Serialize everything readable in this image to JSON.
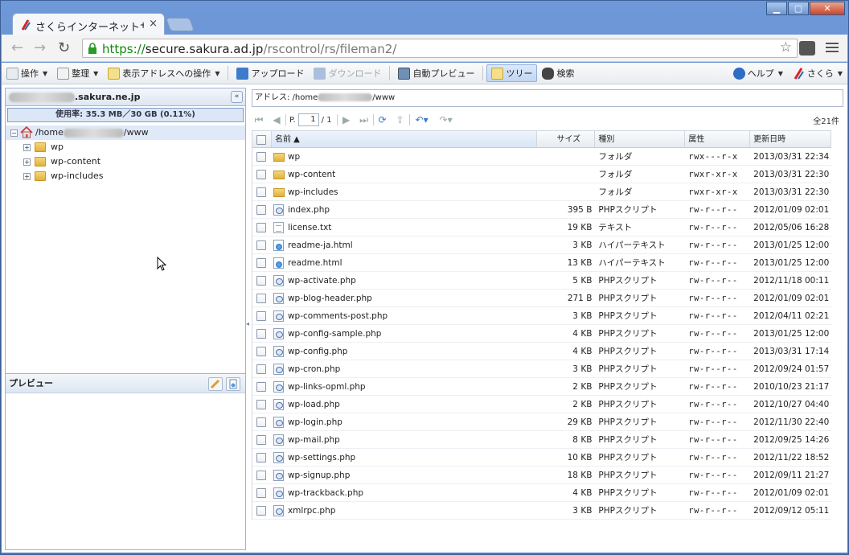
{
  "browser": {
    "tab_title": "さくらインターネットサ…",
    "url_scheme": "https://",
    "url_host": "secure.sakura.ad.jp",
    "url_path": "/rscontrol/rs/fileman2/"
  },
  "toolbar": {
    "operation": "操作",
    "organize": "整理",
    "address_ops": "表示アドレスへの操作",
    "upload": "アップロード",
    "download": "ダウンロード",
    "auto_preview": "自動プレビュー",
    "tree": "ツリー",
    "search": "検索",
    "help": "ヘルプ",
    "sakura": "さくら"
  },
  "left": {
    "domain_suffix": ".sakura.ne.jp",
    "usage": "使用率: 35.3 MB／30 GB (0.11%)",
    "root_prefix": "/home",
    "root_suffix": "/www",
    "tree_items": [
      "wp",
      "wp-content",
      "wp-includes"
    ],
    "preview_label": "プレビュー"
  },
  "right": {
    "address_prefix": "アドレス: /home",
    "address_suffix": "/www",
    "page_label": "P.",
    "page_current": "1",
    "page_total": "/ 1",
    "total": "全21件",
    "columns": [
      "名前 ▲",
      "サイズ",
      "種別",
      "属性",
      "更新日時"
    ],
    "files": [
      {
        "name": "wp",
        "size": "",
        "type": "フォルダ",
        "perm": "rwx---r-x",
        "date": "2013/03/31 22:34",
        "icon": "folder"
      },
      {
        "name": "wp-content",
        "size": "",
        "type": "フォルダ",
        "perm": "rwxr-xr-x",
        "date": "2013/03/31 22:30",
        "icon": "folder"
      },
      {
        "name": "wp-includes",
        "size": "",
        "type": "フォルダ",
        "perm": "rwxr-xr-x",
        "date": "2013/03/31 22:30",
        "icon": "folder"
      },
      {
        "name": "index.php",
        "size": "395 B",
        "type": "PHPスクリプト",
        "perm": "rw-r--r--",
        "date": "2012/01/09 02:01",
        "icon": "php"
      },
      {
        "name": "license.txt",
        "size": "19 KB",
        "type": "テキスト",
        "perm": "rw-r--r--",
        "date": "2012/05/06 16:28",
        "icon": "txt"
      },
      {
        "name": "readme-ja.html",
        "size": "3 KB",
        "type": "ハイパーテキスト",
        "perm": "rw-r--r--",
        "date": "2013/01/25 12:00",
        "icon": "html"
      },
      {
        "name": "readme.html",
        "size": "13 KB",
        "type": "ハイパーテキスト",
        "perm": "rw-r--r--",
        "date": "2013/01/25 12:00",
        "icon": "html"
      },
      {
        "name": "wp-activate.php",
        "size": "5 KB",
        "type": "PHPスクリプト",
        "perm": "rw-r--r--",
        "date": "2012/11/18 00:11",
        "icon": "php"
      },
      {
        "name": "wp-blog-header.php",
        "size": "271 B",
        "type": "PHPスクリプト",
        "perm": "rw-r--r--",
        "date": "2012/01/09 02:01",
        "icon": "php"
      },
      {
        "name": "wp-comments-post.php",
        "size": "3 KB",
        "type": "PHPスクリプト",
        "perm": "rw-r--r--",
        "date": "2012/04/11 02:21",
        "icon": "php"
      },
      {
        "name": "wp-config-sample.php",
        "size": "4 KB",
        "type": "PHPスクリプト",
        "perm": "rw-r--r--",
        "date": "2013/01/25 12:00",
        "icon": "php"
      },
      {
        "name": "wp-config.php",
        "size": "4 KB",
        "type": "PHPスクリプト",
        "perm": "rw-r--r--",
        "date": "2013/03/31 17:14",
        "icon": "php"
      },
      {
        "name": "wp-cron.php",
        "size": "3 KB",
        "type": "PHPスクリプト",
        "perm": "rw-r--r--",
        "date": "2012/09/24 01:57",
        "icon": "php"
      },
      {
        "name": "wp-links-opml.php",
        "size": "2 KB",
        "type": "PHPスクリプト",
        "perm": "rw-r--r--",
        "date": "2010/10/23 21:17",
        "icon": "php"
      },
      {
        "name": "wp-load.php",
        "size": "2 KB",
        "type": "PHPスクリプト",
        "perm": "rw-r--r--",
        "date": "2012/10/27 04:40",
        "icon": "php"
      },
      {
        "name": "wp-login.php",
        "size": "29 KB",
        "type": "PHPスクリプト",
        "perm": "rw-r--r--",
        "date": "2012/11/30 22:40",
        "icon": "php"
      },
      {
        "name": "wp-mail.php",
        "size": "8 KB",
        "type": "PHPスクリプト",
        "perm": "rw-r--r--",
        "date": "2012/09/25 14:26",
        "icon": "php"
      },
      {
        "name": "wp-settings.php",
        "size": "10 KB",
        "type": "PHPスクリプト",
        "perm": "rw-r--r--",
        "date": "2012/11/22 18:52",
        "icon": "php"
      },
      {
        "name": "wp-signup.php",
        "size": "18 KB",
        "type": "PHPスクリプト",
        "perm": "rw-r--r--",
        "date": "2012/09/11 21:27",
        "icon": "php"
      },
      {
        "name": "wp-trackback.php",
        "size": "4 KB",
        "type": "PHPスクリプト",
        "perm": "rw-r--r--",
        "date": "2012/01/09 02:01",
        "icon": "php"
      },
      {
        "name": "xmlrpc.php",
        "size": "3 KB",
        "type": "PHPスクリプト",
        "perm": "rw-r--r--",
        "date": "2012/09/12 05:11",
        "icon": "php"
      }
    ]
  }
}
